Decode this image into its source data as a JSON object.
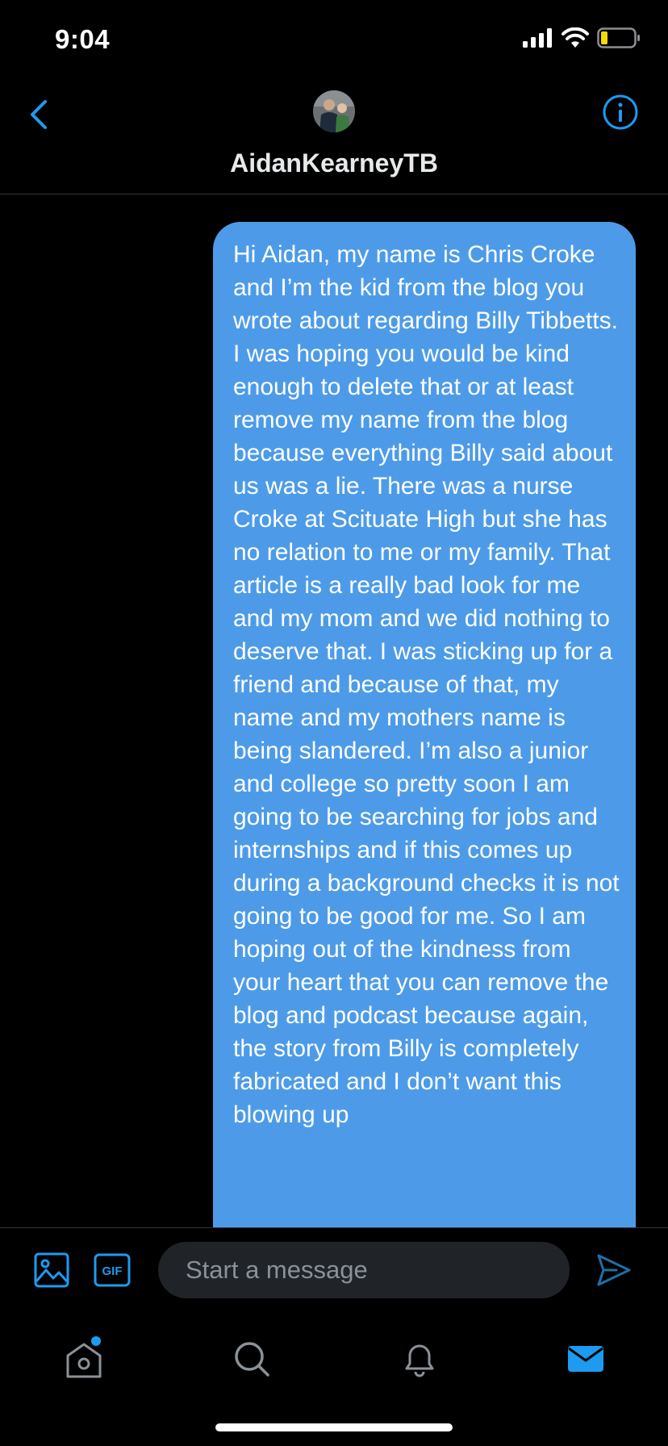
{
  "status_bar": {
    "time": "9:04"
  },
  "header": {
    "username": "AidanKearneyTB",
    "back_icon": "chevron-left-icon",
    "info_icon": "info-icon"
  },
  "message": {
    "text": "Hi Aidan, my name is Chris Croke and I’m the kid from the blog you wrote about regarding Billy Tibbetts. I was hoping you would be kind enough to delete that or at least remove my name from the blog because everything Billy said about us was a lie. There was a nurse Croke at Scituate High but she has no relation to me or my family. That article is a really bad look for me and my mom and we did nothing to deserve that. I was sticking up for a friend and because of that, my name and my mothers name is being slandered. I’m also a junior and college so pretty soon I am going to be searching for jobs and internships and if this comes up during a background checks it is not going to be good for me. So I am hoping out of the kindness from your heart that you can remove the blog and podcast because again, the story from Billy is completely fabricated and I don’t want this blowing up"
  },
  "composer": {
    "placeholder": "Start a message",
    "gif_label": "GIF"
  },
  "tabs": [
    "home",
    "search",
    "notifications",
    "messages"
  ],
  "colors": {
    "accent": "#1d9bf0",
    "bubble": "#4d9be8",
    "input_bg": "#202327",
    "battery_low": "#f5d90a"
  }
}
